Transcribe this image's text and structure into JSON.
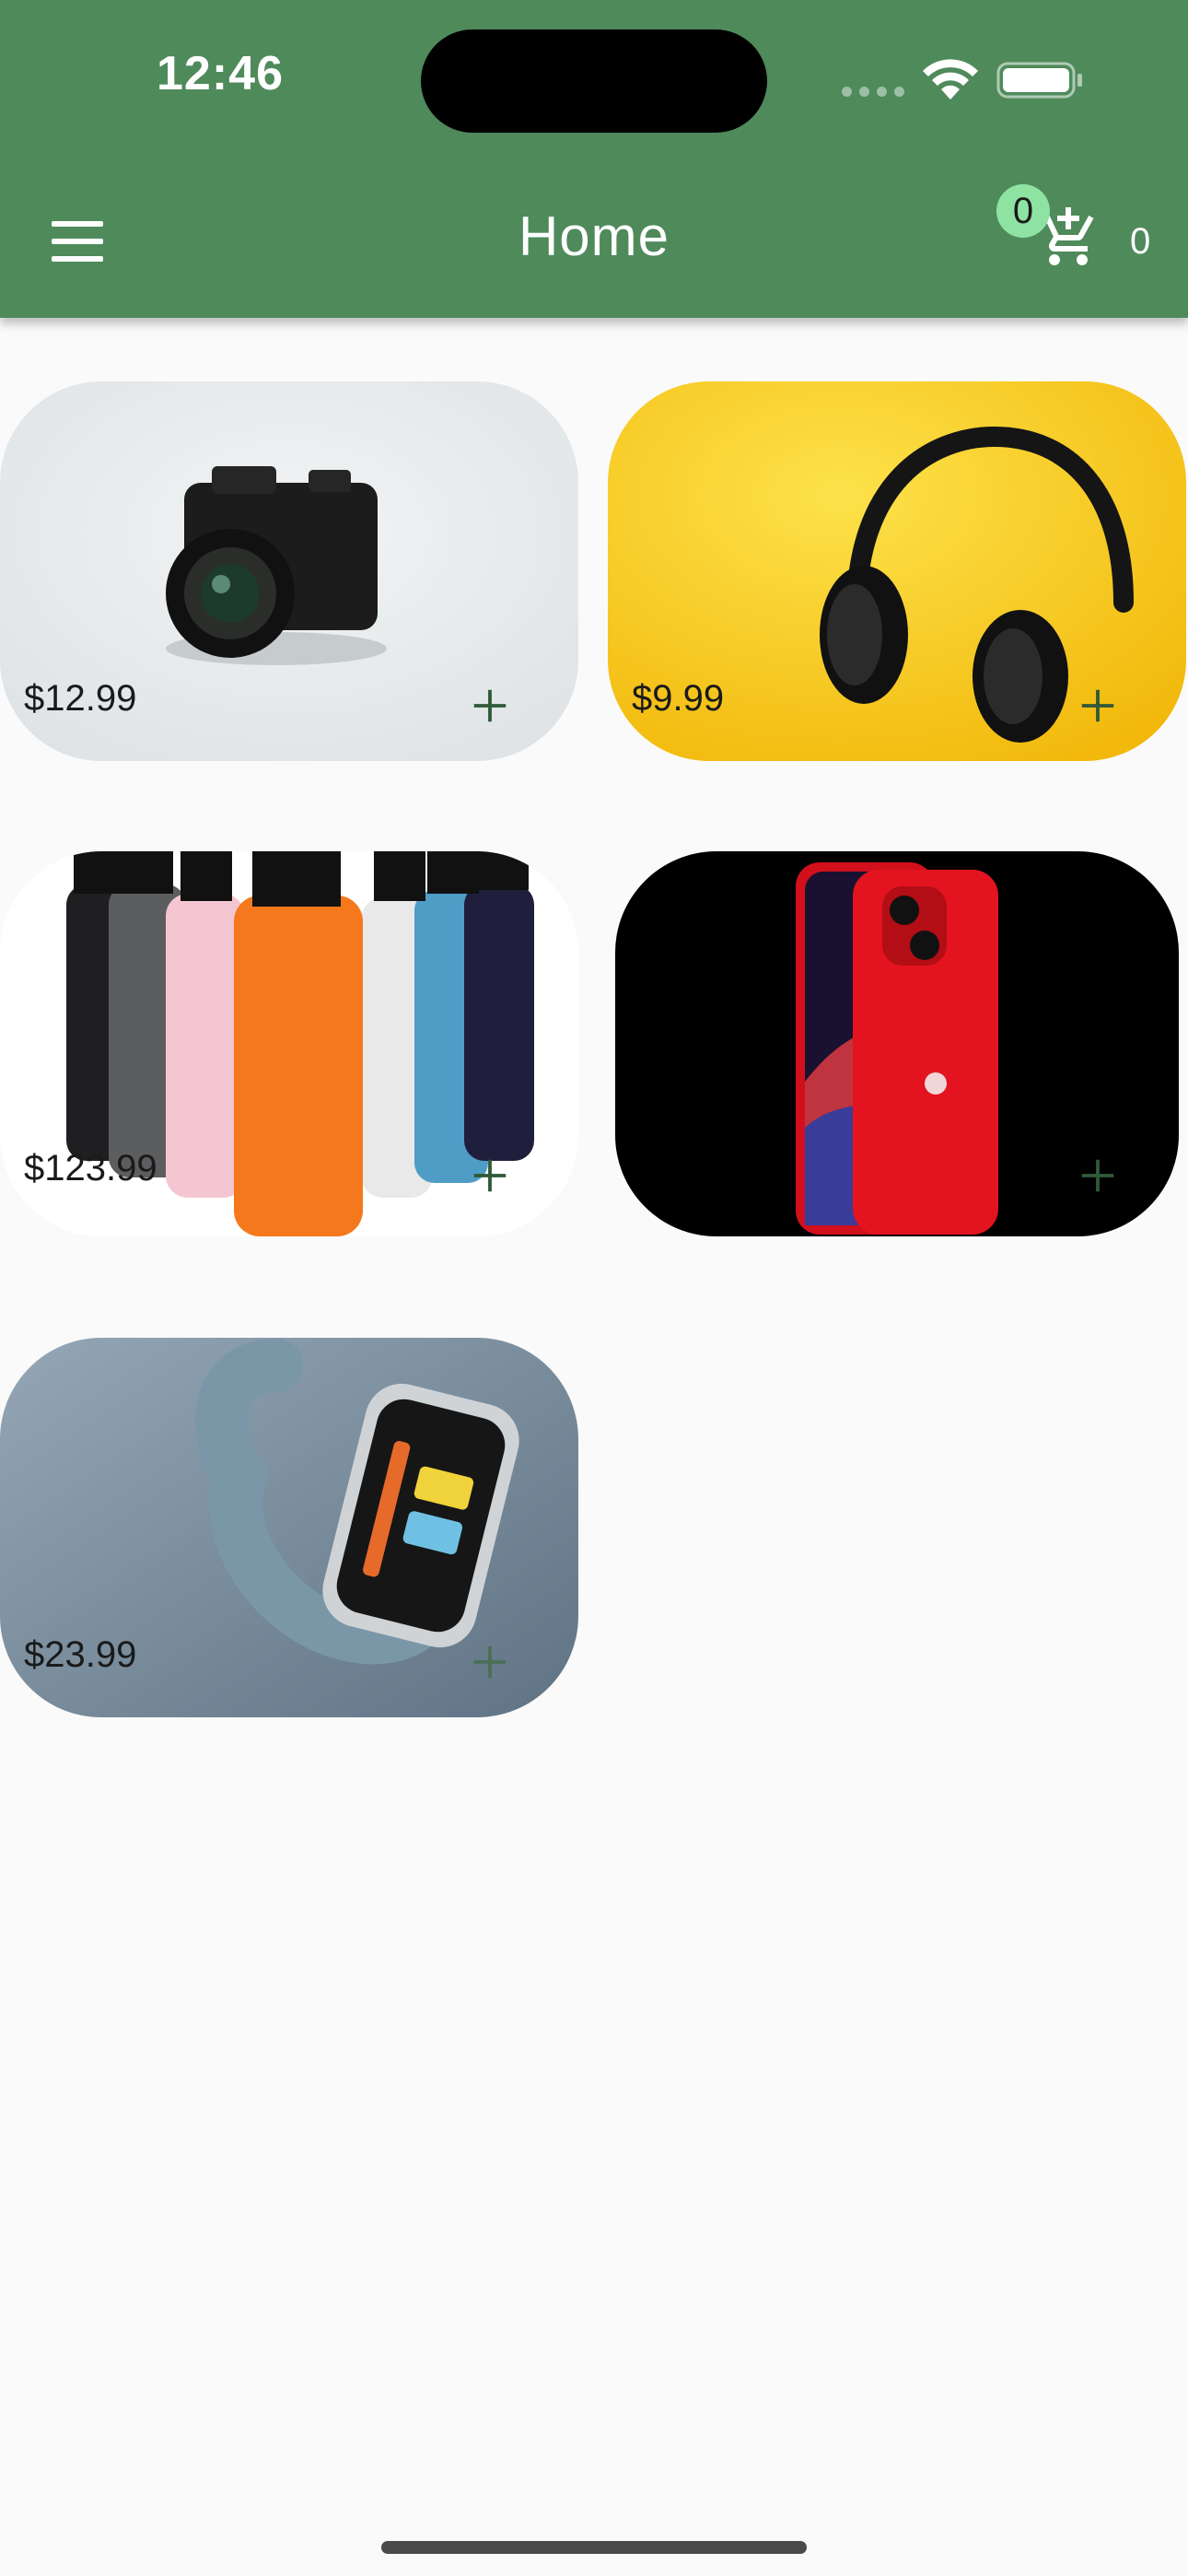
{
  "status_bar": {
    "time": "12:46"
  },
  "app_bar": {
    "title": "Home",
    "menu_icon": "menu-icon",
    "cart": {
      "icon": "add-shopping-cart-icon",
      "badge": "0",
      "count": "0",
      "badge_color": "#8ee3a2"
    },
    "color": "#4f8a5b"
  },
  "products": [
    {
      "price": "$12.99",
      "image": "camera",
      "add_icon": "plus-icon"
    },
    {
      "price": "$9.99",
      "image": "headphones",
      "add_icon": "plus-icon"
    },
    {
      "price": "$123.99",
      "image": "water-bottles",
      "add_icon": "plus-icon"
    },
    {
      "price": "",
      "image": "red-smartphone",
      "add_icon": "plus-icon"
    },
    {
      "price": "$23.99",
      "image": "fitness-tracker",
      "add_icon": "plus-icon"
    }
  ]
}
